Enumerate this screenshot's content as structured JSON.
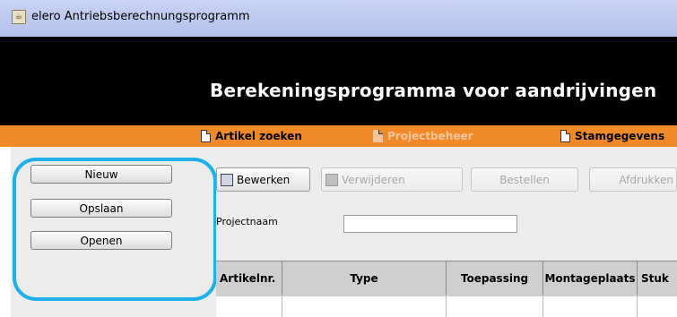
{
  "window": {
    "title": "elero Antriebsberechnungsprogramm"
  },
  "header": {
    "heading": "Berekeningsprogramma voor aandrijvingen"
  },
  "menu": {
    "items": [
      {
        "label": "Artikel zoeken",
        "enabled": true
      },
      {
        "label": "Projectbeheer",
        "enabled": false
      },
      {
        "label": "Stamgegevens",
        "enabled": true
      }
    ]
  },
  "sidebar": {
    "buttons": [
      {
        "label": "Nieuw"
      },
      {
        "label": "Opslaan"
      },
      {
        "label": "Openen"
      }
    ]
  },
  "toolbar": {
    "edit_label": "Bewerken",
    "delete_label": "Verwijderen",
    "order_label": "Bestellen",
    "print_label": "Afdrukken"
  },
  "form": {
    "project_name_label": "Projectnaam",
    "project_name_value": ""
  },
  "table": {
    "columns": [
      "Artikelnr.",
      "Type",
      "Toepassing",
      "Montageplaats",
      "Stuk"
    ]
  },
  "colors": {
    "menu_bar": "#f08a28",
    "header": "#000000",
    "highlight": "#1fb0ea"
  },
  "icons": {
    "app": "java-app-icon",
    "menu": "document-icon",
    "edit": "edit-icon",
    "delete": "trash-icon"
  }
}
